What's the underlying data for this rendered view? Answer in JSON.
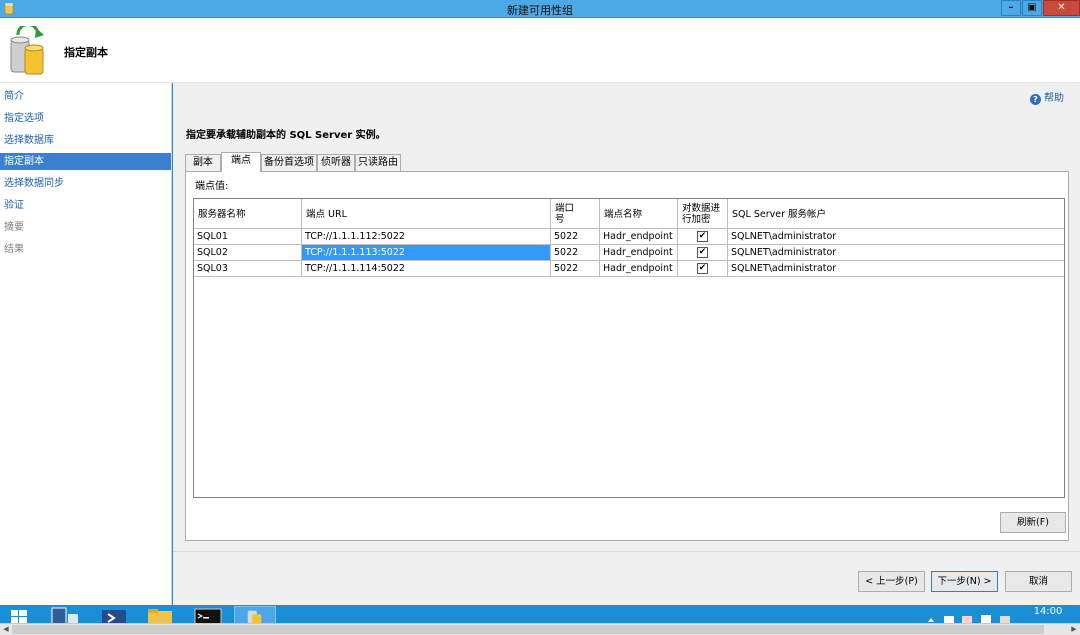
{
  "window": {
    "title": "新建可用性组",
    "min_label": "–",
    "max_label": "▣",
    "close_label": "✕"
  },
  "header": {
    "title": "指定副本"
  },
  "sidebar": {
    "items": [
      {
        "label": "简介",
        "state": "link"
      },
      {
        "label": "指定选项",
        "state": "link"
      },
      {
        "label": "选择数据库",
        "state": "link"
      },
      {
        "label": "指定副本",
        "state": "active"
      },
      {
        "label": "选择数据同步",
        "state": "link"
      },
      {
        "label": "验证",
        "state": "link"
      },
      {
        "label": "摘要",
        "state": "disabled"
      },
      {
        "label": "结果",
        "state": "disabled"
      }
    ]
  },
  "main": {
    "help": "帮助",
    "instruction": "指定要承载辅助副本的 SQL Server 实例。",
    "tabs": [
      {
        "label": "副本",
        "active": false
      },
      {
        "label": "端点",
        "active": true
      },
      {
        "label": "备份首选项",
        "active": false
      },
      {
        "label": "侦听器",
        "active": false
      },
      {
        "label": "只读路由",
        "active": false
      }
    ],
    "panel_label": "端点值:",
    "table": {
      "headers": [
        "服务器名称",
        "端点 URL",
        "端口号",
        "端点名称",
        "对数据进行加密",
        "SQL Server 服务帐户"
      ],
      "rows": [
        {
          "server": "SQL01",
          "url": "TCP://1.1.1.112:5022",
          "port": "5022",
          "endpoint": "Hadr_endpoint",
          "encrypt": true,
          "account": "SQLNET\\administrator"
        },
        {
          "server": "SQL02",
          "url": "TCP://1.1.1.113:5022",
          "port": "5022",
          "endpoint": "Hadr_endpoint",
          "encrypt": true,
          "account": "SQLNET\\administrator"
        },
        {
          "server": "SQL03",
          "url": "TCP://1.1.1.114:5022",
          "port": "5022",
          "endpoint": "Hadr_endpoint",
          "encrypt": true,
          "account": "SQLNET\\administrator"
        }
      ]
    },
    "refresh_button": "刷新(F)"
  },
  "footer": {
    "prev_button": "< 上一步(P)",
    "next_button": "下一步(N) >",
    "cancel_button": "取消"
  },
  "taskbar": {
    "time": "14:00"
  },
  "colors": {
    "accent": "#3a7fd0",
    "selection": "#3399ff",
    "link": "#1f5fa9",
    "taskbar": "#1a8fd6"
  }
}
